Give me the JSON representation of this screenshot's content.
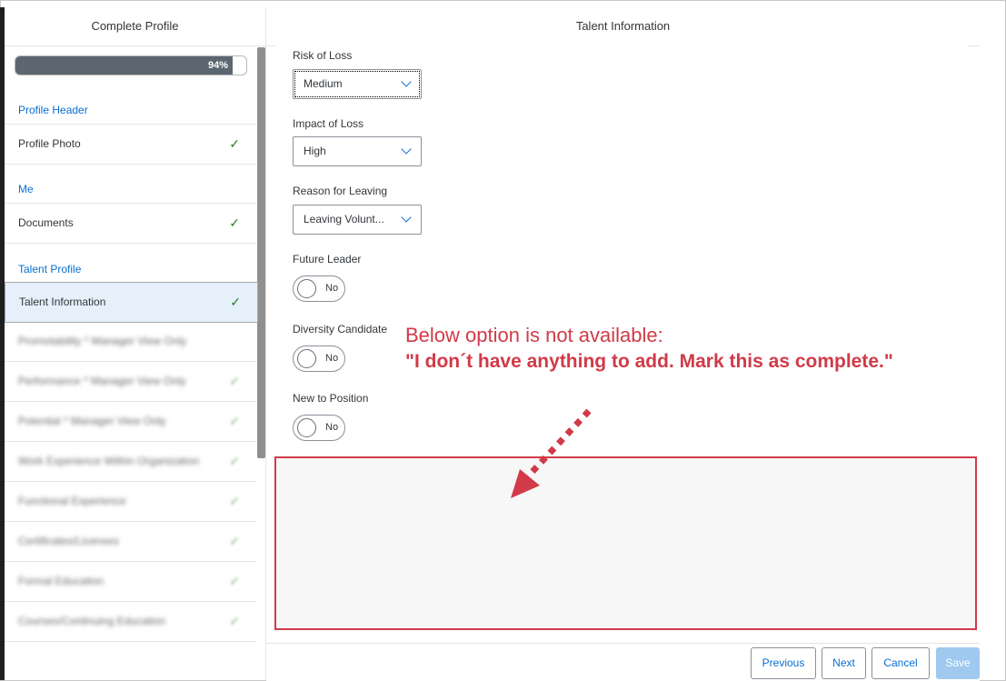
{
  "left_panel": {
    "title": "Complete Profile",
    "progress": {
      "percent": 0.94,
      "label": "94%"
    },
    "groups": {
      "profile_header": "Profile Header",
      "me": "Me",
      "talent_profile": "Talent Profile"
    },
    "items": [
      {
        "label": "Profile Photo",
        "check": "✓"
      },
      {
        "label": "Documents",
        "check": "✓"
      },
      {
        "label": "Talent Information",
        "check": "✓"
      }
    ],
    "blurred_items": [
      {
        "label": "Promotability * Manager View Only",
        "check": ""
      },
      {
        "label": "Performance * Manager View Only",
        "check": "✓"
      },
      {
        "label": "Potential * Manager View Only",
        "check": "✓"
      },
      {
        "label": "Work Experience Within Organization",
        "check": "✓"
      },
      {
        "label": "Functional Experience",
        "check": "✓"
      },
      {
        "label": "Certificates/Licenses",
        "check": "✓"
      },
      {
        "label": "Formal Education",
        "check": "✓"
      },
      {
        "label": "Courses/Continuing Education",
        "check": "✓"
      }
    ]
  },
  "right_panel": {
    "title": "Talent Information",
    "fields": {
      "risk_of_loss": {
        "label": "Risk of Loss",
        "value": "Medium"
      },
      "impact_of_loss": {
        "label": "Impact of Loss",
        "value": "High"
      },
      "reason_for_leaving": {
        "label": "Reason for Leaving",
        "value": "Leaving Volunt..."
      },
      "future_leader": {
        "label": "Future Leader",
        "value": "No"
      },
      "diversity_candidate": {
        "label": "Diversity Candidate",
        "value": "No"
      },
      "new_to_position": {
        "label": "New to Position",
        "value": "No"
      }
    }
  },
  "annotation": {
    "line1": "Below option is not available:",
    "line2": "\"I don´t have anything to add. Mark this as complete.\"",
    "color": "#d13a48"
  },
  "footer": {
    "previous": "Previous",
    "next": "Next",
    "cancel": "Cancel",
    "save": "Save"
  },
  "colors": {
    "accent": "#0a6ed1",
    "check": "#2b7d2b",
    "progress_fill": "#5b6670"
  }
}
